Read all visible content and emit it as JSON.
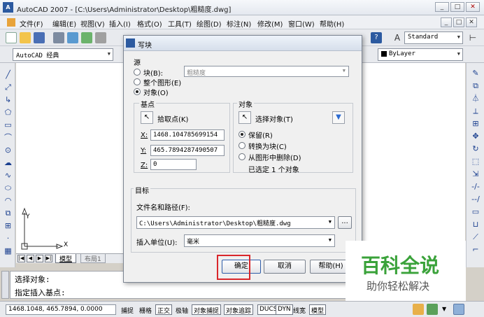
{
  "app": {
    "title": "AutoCAD 2007 - [C:\\Users\\Administrator\\Desktop\\粗糙度.dwg]",
    "logo_text": "A"
  },
  "window_controls": {
    "minimize": "_",
    "maximize": "□",
    "close": "✕"
  },
  "menu": [
    "文件(F)",
    "编辑(E)",
    "视图(V)",
    "插入(I)",
    "格式(O)",
    "工具(T)",
    "绘图(D)",
    "标注(N)",
    "修改(M)",
    "窗口(W)",
    "帮助(H)"
  ],
  "toolbar": {
    "text_style": "Standard",
    "workspace": "AutoCAD 经典",
    "layer": "ByLayer"
  },
  "tabs": {
    "model": "模型",
    "layout": "布局1"
  },
  "command": {
    "line1": "选择对象:",
    "line2": "指定插入基点:"
  },
  "status": {
    "coords": "1468.1048, 465.7894, 0.0000",
    "buttons": [
      "捕捉",
      "栅格",
      "正交",
      "极轴",
      "对象捕捉",
      "对象追踪",
      "DUCS",
      "DYN",
      "线宽",
      "模型"
    ]
  },
  "dialog": {
    "title": "写块",
    "source_label": "源",
    "radio_block": "块(B):",
    "block_combo_value": "粗糙度",
    "radio_whole": "整个图形(E)",
    "radio_objects": "对象(O)",
    "basepoint_label": "基点",
    "pick_point": "拾取点(K)",
    "x_label": "X:",
    "x_value": "1468.104785699154",
    "y_label": "Y:",
    "y_value": "465.7894287490507",
    "z_label": "Z:",
    "z_value": "0",
    "objects_label": "对象",
    "select_objects": "选择对象(T)",
    "retain": "保留(R)",
    "convert": "转换为块(C)",
    "delete": "从图形中删除(D)",
    "selected_info": "已选定 1 个对象",
    "target_label": "目标",
    "filename_label": "文件名和路径(F):",
    "filename_value": "C:\\Users\\Administrator\\Desktop\\粗糙度.dwg",
    "browse": "...",
    "units_label": "插入单位(U):",
    "units_value": "毫米",
    "ok": "确定",
    "cancel": "取消",
    "help": "帮助(H)"
  },
  "ucs": {
    "x_label": "X",
    "y_label": "Y"
  },
  "watermark": {
    "title": "百科全说",
    "subtitle": "助你轻松解决"
  },
  "colors": {
    "highlight": "#d9262b",
    "watermark_green": "#3aa23a"
  }
}
